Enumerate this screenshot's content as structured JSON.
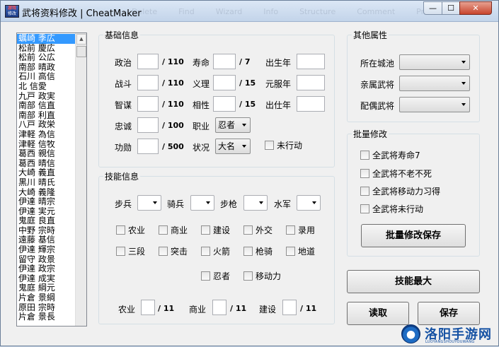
{
  "titlebar": {
    "icon_text_top": "游戏",
    "icon_text_bottom": "修改",
    "title": "武将资料修改 | CheatMaker",
    "faint_tabs": [
      "Delete",
      "Find",
      "Wizard",
      "Info",
      "Structure",
      "Comment",
      "Protect"
    ],
    "min_label": "—",
    "max_label": "☐",
    "close_label": "✕"
  },
  "general_list": {
    "items": [
      "蠣崎 季広",
      "松前 慶広",
      "松前 公広",
      "南部 晴政",
      "石川 高信",
      "北 信愛",
      "九戸 政実",
      "南部 信直",
      "南部 利直",
      "八戸 政栄",
      "津軽 為信",
      "津軽 信牧",
      "葛西 親信",
      "葛西 晴信",
      "大崎 義直",
      "黒川 晴氏",
      "大崎 義隆",
      "伊達 晴宗",
      "伊達 実元",
      "鬼庭 良直",
      "中野 宗時",
      "遠藤 基信",
      "伊達 輝宗",
      "留守 政景",
      "伊達 政宗",
      "伊達 成実",
      "鬼庭 綱元",
      "片倉 景綱",
      "原田 宗時",
      "片倉 景長"
    ],
    "selected_index": 0,
    "scroll_up_icon": "▲"
  },
  "basic_info": {
    "title": "基础信息",
    "fields": {
      "politics": {
        "label": "政治",
        "unit": "/ 110",
        "value": ""
      },
      "lifespan": {
        "label": "寿命",
        "unit": "/ 7",
        "value": ""
      },
      "birth_year": {
        "label": "出生年",
        "value": ""
      },
      "battle": {
        "label": "战斗",
        "unit": "/ 110",
        "value": ""
      },
      "justice": {
        "label": "义理",
        "unit": "/ 15",
        "value": ""
      },
      "coming_of_age_year": {
        "label": "元服年",
        "value": ""
      },
      "intellect": {
        "label": "智谋",
        "unit": "/ 110",
        "value": ""
      },
      "affinity": {
        "label": "相性",
        "unit": "/ 15",
        "value": ""
      },
      "service_year": {
        "label": "出仕年",
        "value": ""
      },
      "loyalty": {
        "label": "忠诚",
        "unit": "/ 100",
        "value": ""
      },
      "merit": {
        "label": "功勋",
        "unit": "/ 500",
        "value": ""
      }
    },
    "job": {
      "label": "职业",
      "value": "忍者"
    },
    "status": {
      "label": "状况",
      "value": "大名"
    },
    "not_acted": {
      "label": "未行动"
    }
  },
  "skill_info": {
    "title": "技能信息",
    "aptitudes": {
      "infantry": {
        "label": "步兵",
        "value": ""
      },
      "cavalry": {
        "label": "骑兵",
        "value": ""
      },
      "spear": {
        "label": "步枪",
        "value": ""
      },
      "navy": {
        "label": "水军",
        "value": ""
      }
    },
    "skills_row1": [
      "农业",
      "商业",
      "建设",
      "外交",
      "录用"
    ],
    "skills_row2": [
      "三段",
      "突击",
      "火箭",
      "枪骑",
      "地道"
    ],
    "skills_row3": [
      "忍者",
      "移动力"
    ],
    "levels": {
      "agriculture": {
        "label": "农业",
        "unit": "/ 11",
        "value": ""
      },
      "commerce": {
        "label": "商业",
        "unit": "/ 11",
        "value": ""
      },
      "construction": {
        "label": "建设",
        "unit": "/ 11",
        "value": ""
      }
    }
  },
  "other_attributes": {
    "title": "其他属性",
    "city": {
      "label": "所在城池",
      "value": ""
    },
    "relative": {
      "label": "亲属武将",
      "value": ""
    },
    "spouse": {
      "label": "配偶武将",
      "value": ""
    }
  },
  "batch_edit": {
    "title": "批量修改",
    "options": [
      "全武将寿命7",
      "全武将不老不死",
      "全武将移动力习得",
      "全武将未行动"
    ],
    "save_button": "批量修改保存"
  },
  "actions": {
    "max_skills": "技能最大",
    "read": "读取",
    "save": "保存"
  },
  "watermark": {
    "text": "洛阳手游网",
    "sub": "LUOYANGSHOUYOUWANG"
  },
  "colors": {
    "selection": "#3399ff",
    "window_bg": "#f0f0f0",
    "titlebar": "#c3d4ea",
    "close_button": "#c7442c",
    "watermark": "#1551a3"
  }
}
